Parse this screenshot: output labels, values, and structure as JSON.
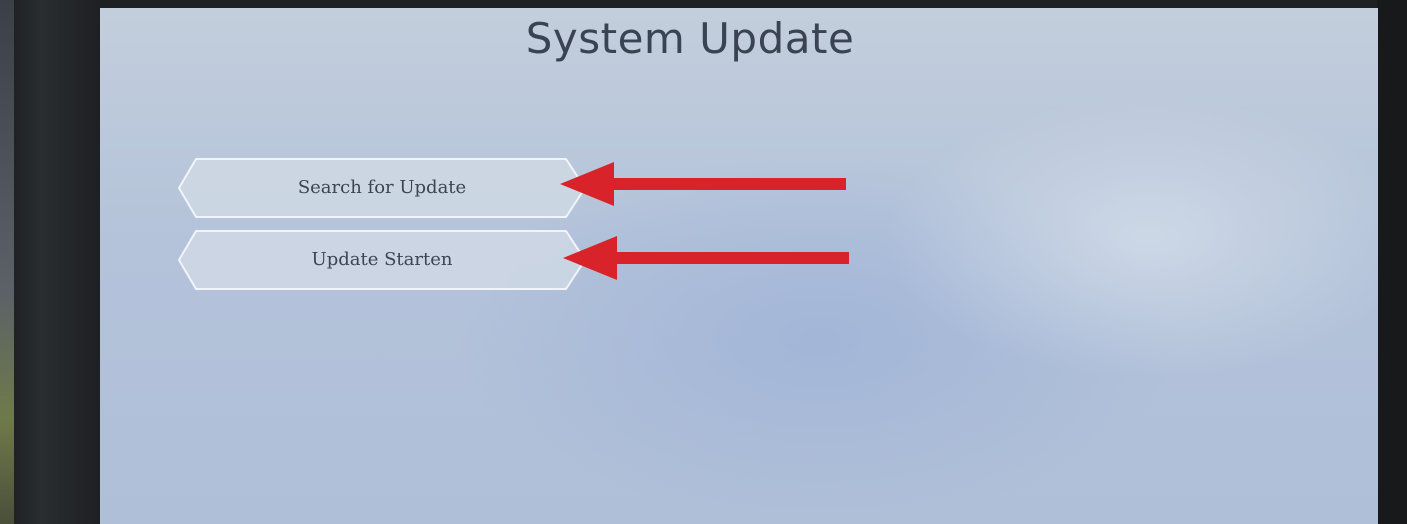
{
  "screen": {
    "title": "System Update"
  },
  "menu": {
    "items": [
      {
        "label": "Search for Update"
      },
      {
        "label": "Update Starten"
      }
    ]
  },
  "annotations": {
    "arrow_color": "#d8232a"
  },
  "colors": {
    "screen_background": "#b7c5db",
    "button_fill": "#cdd6e2",
    "button_border": "#eef2f7",
    "text": "#3c4452"
  }
}
